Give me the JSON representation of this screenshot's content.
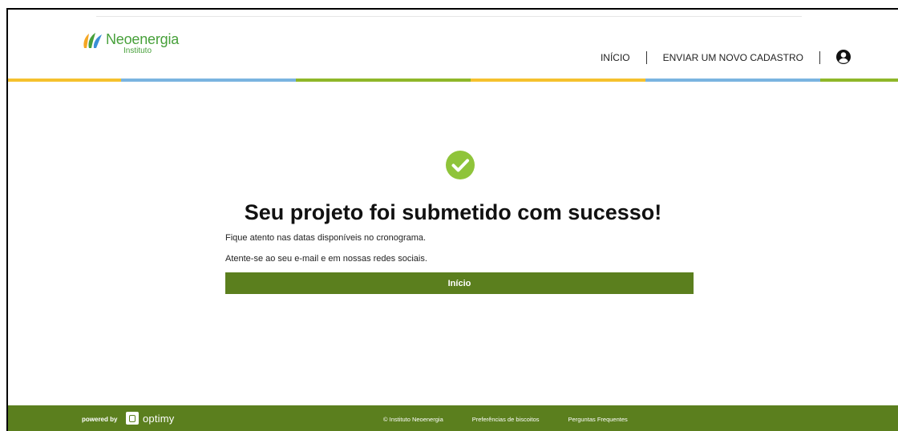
{
  "header": {
    "logo_name": "Neoenergia",
    "logo_sub": "Instituto",
    "nav": [
      {
        "label": "INÍCIO"
      },
      {
        "label": "ENVIAR UM NOVO CADASTRO"
      }
    ],
    "user_icon": "user-circle-icon"
  },
  "stripe_colors": [
    "#f5c12e",
    "#7ab4e0",
    "#8fb729",
    "#f5c12e",
    "#7ab4e0",
    "#8fb729"
  ],
  "main": {
    "status_icon": "check-circle-icon",
    "title": "Seu projeto foi submetido com sucesso!",
    "message1": "Fique atento nas datas disponíveis no cronograma.",
    "message2": "Atente-se ao seu e-mail e em nossas redes sociais.",
    "button_label": "Início"
  },
  "footer": {
    "powered_by": "powered by",
    "brand": "optimy",
    "links": [
      {
        "label": "© Instituto Neoenergia"
      },
      {
        "label": "Preferências de biscoitos"
      },
      {
        "label": "Perguntas Frequentes"
      }
    ]
  },
  "colors": {
    "brand_green": "#5b7f1e",
    "logo_green": "#47a03a",
    "success_green": "#8fc43a"
  }
}
